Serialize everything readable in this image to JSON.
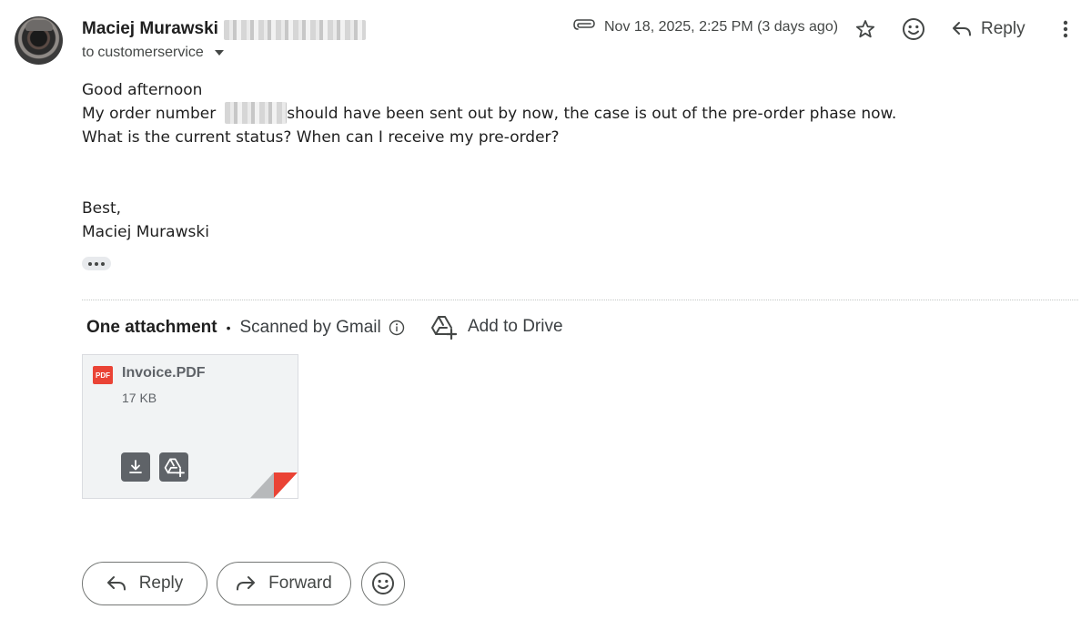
{
  "header": {
    "sender_name": "Maciej Murawski",
    "recipient_prefix": "to",
    "recipient": "customerservice",
    "date": "Nov 18, 2025, 2:25 PM (3 days ago)",
    "reply_label": "Reply"
  },
  "body": {
    "greeting": "Good afternoon",
    "line1_start": "My order number",
    "line1_end": "should have been sent out by now, the case is out of the pre-order phase now.",
    "line2": "What is the current status? When can I receive my pre-order?",
    "signoff": "Best,",
    "signature": "Maciej Murawski"
  },
  "attachments": {
    "count_label": "One attachment",
    "separator": "•",
    "scanned_label": "Scanned by Gmail",
    "add_to_drive_label": "Add to Drive",
    "file": {
      "badge": "PDF",
      "name": "Invoice.PDF",
      "size": "17 KB"
    }
  },
  "actions": {
    "reply_label": "Reply",
    "forward_label": "Forward"
  },
  "icons": {
    "attachment": "paperclip-icon",
    "star": "star-icon",
    "emoji": "smiley-icon",
    "reply": "reply-arrow-icon",
    "more": "more-vert-icon",
    "info": "info-icon",
    "drive": "add-to-drive-icon",
    "download": "download-icon",
    "forward": "forward-arrow-icon"
  },
  "colors": {
    "pdf_red": "#ea4335",
    "text": "#1f1f1f",
    "muted": "#444746"
  }
}
